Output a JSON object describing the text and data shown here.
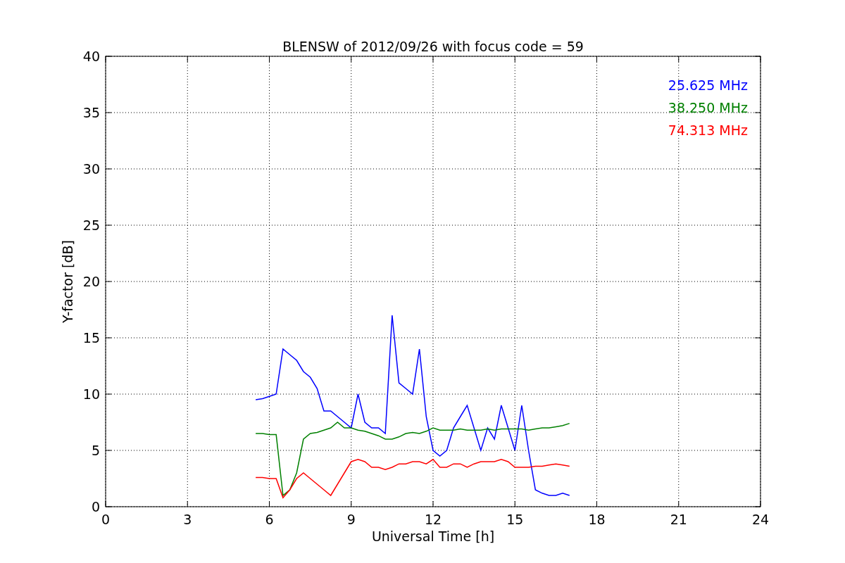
{
  "chart_data": {
    "type": "line",
    "title": "BLENSW of 2012/09/26 with focus code = 59",
    "xlabel": "Universal Time [h]",
    "ylabel": "Y-factor [dB]",
    "x": [
      5.5,
      5.75,
      6,
      6.25,
      6.5,
      6.75,
      7,
      7.25,
      7.5,
      7.75,
      8,
      8.25,
      8.5,
      8.75,
      9,
      9.25,
      9.5,
      9.75,
      10,
      10.25,
      10.5,
      10.75,
      11,
      11.25,
      11.5,
      11.75,
      12,
      12.25,
      12.5,
      12.75,
      13,
      13.25,
      13.5,
      13.75,
      14,
      14.25,
      14.5,
      14.75,
      15,
      15.25,
      15.5,
      15.75,
      16,
      16.25,
      16.5,
      16.75,
      17
    ],
    "series": [
      {
        "name": "25.625 MHz",
        "color": "#0000ff",
        "values": [
          9.5,
          9.6,
          9.8,
          10,
          14,
          13.5,
          13,
          12,
          11.5,
          10.5,
          8.5,
          8.5,
          8,
          7.5,
          7,
          10,
          7.5,
          7,
          7,
          6.5,
          17,
          11,
          10.5,
          10,
          14,
          8,
          5,
          4.5,
          5,
          7,
          8,
          9,
          7,
          5,
          7,
          6,
          9,
          7,
          5,
          9,
          5,
          1.5,
          1.2,
          1,
          1,
          1.2,
          1
        ]
      },
      {
        "name": "38.250 MHz",
        "color": "#008000",
        "values": [
          6.5,
          6.5,
          6.4,
          6.4,
          1,
          1.5,
          3,
          6,
          6.5,
          6.6,
          6.8,
          7,
          7.5,
          7,
          7,
          6.8,
          6.7,
          6.5,
          6.3,
          6,
          6,
          6.2,
          6.5,
          6.6,
          6.5,
          6.7,
          7,
          6.8,
          6.8,
          6.8,
          6.9,
          6.8,
          6.8,
          6.8,
          6.9,
          6.8,
          6.9,
          6.9,
          6.9,
          6.9,
          6.8,
          6.9,
          7,
          7,
          7.1,
          7.2,
          7.4
        ]
      },
      {
        "name": "74.313 MHz",
        "color": "#ff0000",
        "values": [
          2.6,
          2.6,
          2.5,
          2.5,
          0.8,
          1.5,
          2.5,
          3,
          2.5,
          2,
          1.5,
          1,
          2,
          3,
          4,
          4.2,
          4,
          3.5,
          3.5,
          3.3,
          3.5,
          3.8,
          3.8,
          4,
          4,
          3.8,
          4.2,
          3.5,
          3.5,
          3.8,
          3.8,
          3.5,
          3.8,
          4,
          4,
          4,
          4.2,
          4,
          3.5,
          3.5,
          3.5,
          3.6,
          3.6,
          3.7,
          3.8,
          3.7,
          3.6
        ]
      }
    ],
    "grid": true,
    "xlim": [
      0,
      24
    ],
    "ylim": [
      0,
      40
    ],
    "xticks": [
      0,
      3,
      6,
      9,
      12,
      15,
      18,
      21,
      24
    ],
    "yticks": [
      0,
      5,
      10,
      15,
      20,
      25,
      30,
      35,
      40
    ]
  }
}
